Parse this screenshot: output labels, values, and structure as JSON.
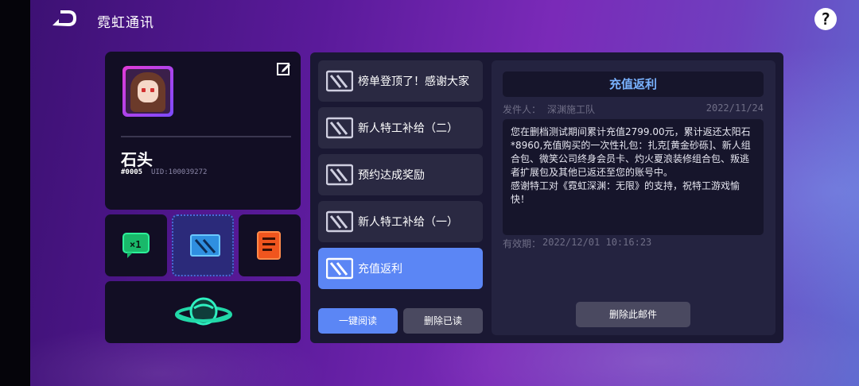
{
  "header": {
    "title": "霓虹通讯",
    "back_icon": "back-arrow-icon",
    "help_symbol": "?"
  },
  "profile": {
    "name": "石头",
    "tag": "#0005",
    "uid": "UID:100039272"
  },
  "mail_list": [
    {
      "label": "榜单登顶了！感谢大家"
    },
    {
      "label": "新人特工补给（二）"
    },
    {
      "label": "预约达成奖励"
    },
    {
      "label": "新人特工补给（一）"
    },
    {
      "label": "充值返利",
      "active": true
    }
  ],
  "buttons": {
    "read_all": "一键阅读",
    "delete_read": "删除已读",
    "delete_mail": "删除此邮件"
  },
  "mail_detail": {
    "title": "充值返利",
    "sender_label": "发件人：",
    "sender": "深渊施工队",
    "date": "2022/11/24",
    "body": "您在删档测试期间累计充值2799.00元，累计返还太阳石*8960,充值购买的一次性礼包：扎克[黄金砂砾]、新人组合包、微笑公司终身会员卡、灼火夏浪装修组合包、叛逃者扩展包及其他已返还至您的账号中。\n感谢特工对《霓虹深渊：无限》的支持，祝特工游戏愉快！",
    "expiry_label": "有效期：",
    "expiry": "2022/12/01 10:16:23"
  },
  "colors": {
    "accent": "#5b86f5",
    "title_blue": "#79b2ff"
  }
}
